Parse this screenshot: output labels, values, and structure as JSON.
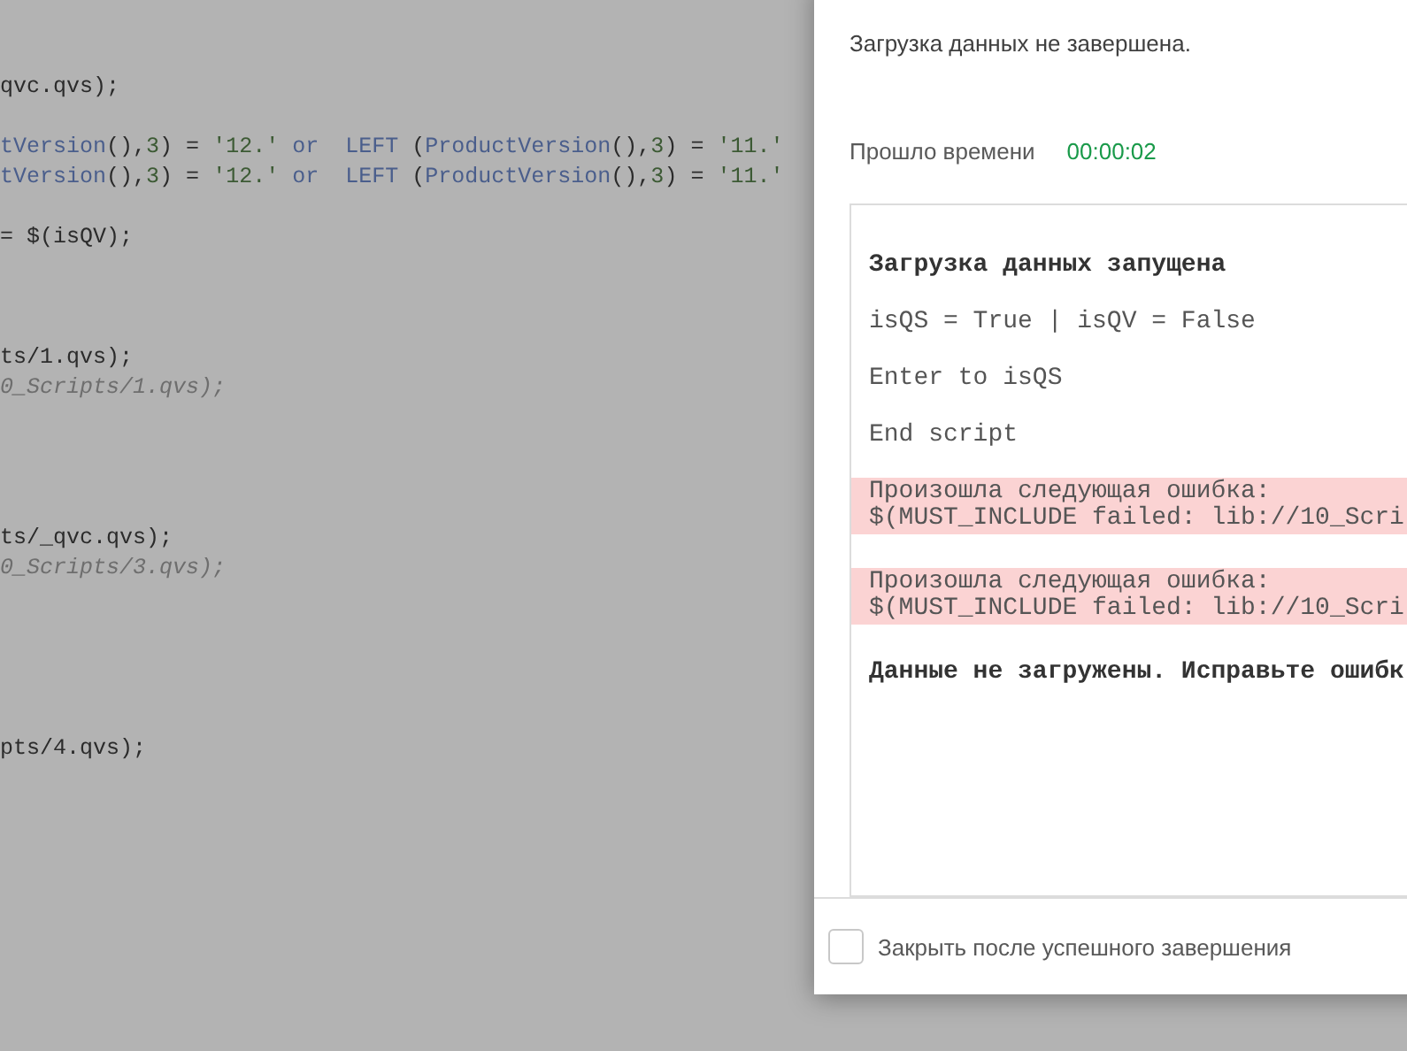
{
  "editor": {
    "lines": [
      {
        "tokens": [
          {
            "kind": "plain",
            "text": "qvc.qvs);"
          }
        ]
      },
      {
        "tokens": [
          {
            "kind": "fn",
            "text": "tVersion"
          },
          {
            "kind": "plain",
            "text": "(),"
          },
          {
            "kind": "num",
            "text": "3"
          },
          {
            "kind": "plain",
            "text": ") = "
          },
          {
            "kind": "str",
            "text": "'12.'"
          },
          {
            "kind": "kw",
            "text": " or"
          },
          {
            "kind": "kw",
            "text": "  LEFT"
          },
          {
            "kind": "plain",
            "text": " ("
          },
          {
            "kind": "fn",
            "text": "ProductVersion"
          },
          {
            "kind": "plain",
            "text": "(),"
          },
          {
            "kind": "num",
            "text": "3"
          },
          {
            "kind": "plain",
            "text": ") = "
          },
          {
            "kind": "str",
            "text": "'11.'"
          }
        ]
      },
      {
        "tokens": [
          {
            "kind": "fn",
            "text": "tVersion"
          },
          {
            "kind": "plain",
            "text": "(),"
          },
          {
            "kind": "num",
            "text": "3"
          },
          {
            "kind": "plain",
            "text": ") = "
          },
          {
            "kind": "str",
            "text": "'12.'"
          },
          {
            "kind": "kw",
            "text": " or"
          },
          {
            "kind": "kw",
            "text": "  LEFT"
          },
          {
            "kind": "plain",
            "text": " ("
          },
          {
            "kind": "fn",
            "text": "ProductVersion"
          },
          {
            "kind": "plain",
            "text": "(),"
          },
          {
            "kind": "num",
            "text": "3"
          },
          {
            "kind": "plain",
            "text": ") = "
          },
          {
            "kind": "str",
            "text": "'11.'"
          }
        ]
      },
      {
        "tokens": [
          {
            "kind": "plain",
            "text": "= $(isQV);"
          }
        ]
      },
      {
        "tokens": [
          {
            "kind": "plain",
            "text": "ts/1.qvs);"
          }
        ]
      },
      {
        "tokens": [
          {
            "kind": "comment",
            "text": "0_Scripts/1.qvs);"
          }
        ]
      },
      {
        "tokens": [
          {
            "kind": "plain",
            "text": "ts/_qvc.qvs);"
          }
        ]
      },
      {
        "tokens": [
          {
            "kind": "comment",
            "text": "0_Scripts/3.qvs);"
          }
        ]
      },
      {
        "tokens": [
          {
            "kind": "plain",
            "text": "pts/4.qvs);"
          }
        ]
      }
    ]
  },
  "dialog": {
    "status": "Загрузка данных не завершена.",
    "elapsed_label": "Прошло времени",
    "elapsed_value": "00:00:02",
    "log": [
      {
        "kind": "heading",
        "text": "Загрузка данных запущена"
      },
      {
        "kind": "line",
        "text": "isQS = True | isQV = False"
      },
      {
        "kind": "line",
        "text": "Enter to isQS"
      },
      {
        "kind": "line",
        "text": "End script"
      },
      {
        "kind": "error",
        "lines": [
          "Произошла следующая ошибка:",
          "$(MUST_INCLUDE failed: lib://10_Scri"
        ]
      },
      {
        "kind": "error",
        "lines": [
          "Произошла следующая ошибка:",
          "$(MUST_INCLUDE failed: lib://10_Scri"
        ]
      },
      {
        "kind": "heading",
        "text": "Данные не загружены. Исправьте ошибк"
      }
    ],
    "close_on_success": {
      "label": "Закрыть после успешного завершения",
      "checked": false
    }
  }
}
